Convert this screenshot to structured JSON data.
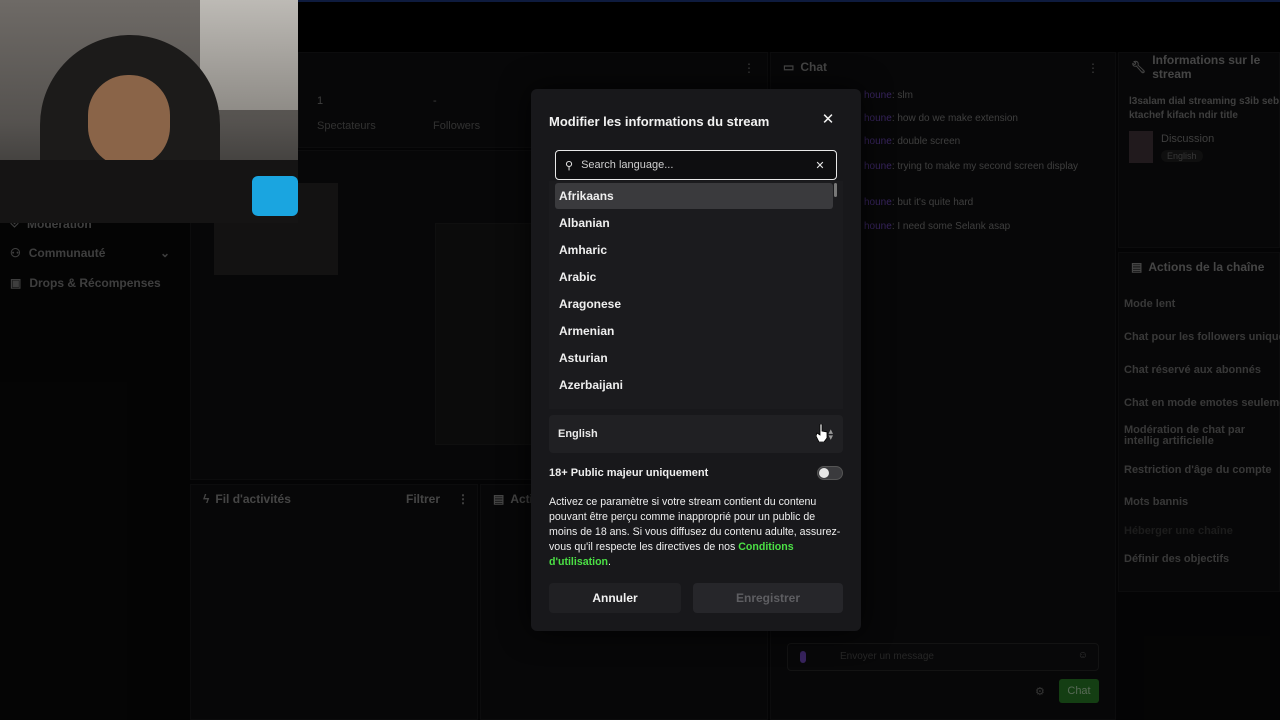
{
  "sidebar": {
    "items": [
      {
        "label": "Modération",
        "icon": "shield-icon"
      },
      {
        "label": "Communauté",
        "icon": "people-icon"
      },
      {
        "label": "Drops & Récompenses",
        "icon": "gift-icon"
      }
    ]
  },
  "stats": {
    "viewers_value": "1",
    "viewers_label": "Spectateurs",
    "followers_value": "-",
    "followers_label": "Followers"
  },
  "panels": {
    "activity_title": "Fil d'activités",
    "activity_filter": "Filtrer",
    "actions_title": "Actio",
    "chat_title": "Chat",
    "stream_info_title": "Informations sur le stream"
  },
  "chat": {
    "messages": [
      {
        "user": "houne",
        "text": ": slm"
      },
      {
        "user": "houne",
        "text": ": how do we make extension"
      },
      {
        "user": "houne",
        "text": ": double screen"
      },
      {
        "user": "houne",
        "text": ": trying to make my second screen display"
      },
      {
        "user": "houne",
        "text": ": but it's quite hard"
      },
      {
        "user": "houne",
        "text": ": I need some Selank asap"
      }
    ],
    "input_placeholder": "Envoyer un message",
    "send_label": "Chat"
  },
  "stream_info": {
    "title": "l3salam dial streaming s3ib seb ktachef kifach ndir title",
    "category": "Discussion",
    "tag": "English"
  },
  "channel_actions": {
    "title": "Actions de la chaîne",
    "items": [
      "Mode lent",
      "Chat pour les followers unique",
      "Chat réservé aux abonnés",
      "Chat en mode emotes seuleme",
      "Modération de chat par intellig artificielle",
      "Restriction d'âge du compte",
      "Mots bannis",
      "Héberger une chaîne",
      "Définir des objectifs"
    ]
  },
  "modal": {
    "title": "Modifier les informations du stream",
    "search_placeholder": "Search language...",
    "languages": [
      "Afrikaans",
      "Albanian",
      "Amharic",
      "Arabic",
      "Aragonese",
      "Armenian",
      "Asturian",
      "Azerbaijani"
    ],
    "selected_language": "English",
    "mature_label": "18+ Public majeur uniquement",
    "mature_enabled": false,
    "description": "Activez ce paramètre si votre stream contient du contenu pouvant être perçu comme inapproprié pour un public de moins de 18 ans. Si vous diffusez du contenu adulte, assurez-vous qu'il respecte les directives de nos ",
    "terms_link": "Conditions d'utilisation",
    "terms_suffix": ".",
    "cancel_label": "Annuler",
    "save_label": "Enregistrer"
  },
  "colors": {
    "accent_green": "#4be045",
    "chat_user": "#7a4fcf",
    "background": "#0b0b0c",
    "modal_bg": "#18181b"
  }
}
